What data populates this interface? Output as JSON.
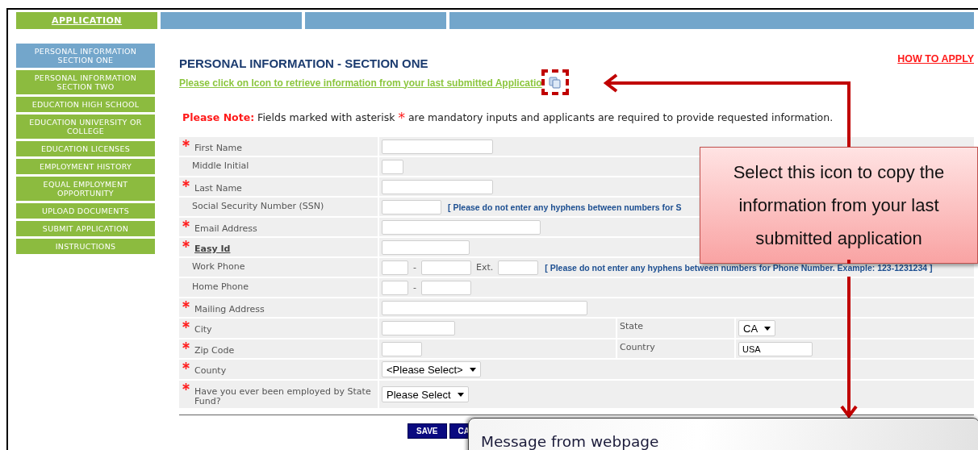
{
  "top_nav": {
    "tabs": [
      {
        "label": "APPLICATION",
        "selected": true
      },
      {
        "selected": false
      },
      {
        "selected": false
      },
      {
        "selected": false
      }
    ]
  },
  "sidebar": {
    "items": [
      {
        "label": "PERSONAL INFORMATION SECTION ONE",
        "selected": true
      },
      {
        "label": "PERSONAL INFORMATION SECTION TWO",
        "selected": false
      },
      {
        "label": "EDUCATION HIGH SCHOOL",
        "selected": false
      },
      {
        "label": "EDUCATION UNIVERSITY OR COLLEGE",
        "selected": false
      },
      {
        "label": "EDUCATION LICENSES",
        "selected": false
      },
      {
        "label": "EMPLOYMENT HISTORY",
        "selected": false
      },
      {
        "label": "EQUAL EMPLOYMENT OPPORTUNITY",
        "selected": false
      },
      {
        "label": "UPLOAD DOCUMENTS",
        "selected": false
      },
      {
        "label": "SUBMIT APPLICATION",
        "selected": false
      },
      {
        "label": "INSTRUCTIONS",
        "selected": false
      }
    ]
  },
  "header": {
    "title": "PERSONAL INFORMATION - SECTION ONE",
    "how_to_apply": "HOW TO APPLY",
    "retrieve_link": "Please click on Icon to retrieve information from your last submitted Applicatio"
  },
  "note": {
    "lead": "Please Note:",
    "before": "Fields marked with asterisk",
    "mark": "*",
    "after": "are mandatory inputs and applicants are required to provide requested information."
  },
  "form": {
    "rows": [
      {
        "kind": "text",
        "label": "First Name",
        "required": true
      },
      {
        "kind": "text",
        "label": "Middle Initial",
        "required": false
      },
      {
        "kind": "text",
        "label": "Last Name",
        "required": true
      },
      {
        "kind": "text",
        "label": "Social Security Number (SSN)",
        "required": false,
        "hint": "[ Please do not enter any hyphens between numbers for S"
      },
      {
        "kind": "text",
        "label": "Email Address",
        "required": true
      },
      {
        "kind": "text",
        "label": "Easy Id",
        "required": true,
        "link": true
      },
      {
        "kind": "phone",
        "label": "Work Phone",
        "required": false,
        "separator": "-",
        "ext_label": "Ext.",
        "hint": "[ Please do not enter any hyphens between numbers for Phone Number. Example: 123-1231234 ]"
      },
      {
        "kind": "phone",
        "label": "Home Phone",
        "required": false,
        "separator": "-"
      },
      {
        "kind": "text",
        "label": "Mailing Address",
        "required": true
      },
      {
        "kind": "text",
        "label": "City",
        "required": true,
        "side": {
          "label": "State",
          "kind": "select",
          "value": "CA"
        }
      },
      {
        "kind": "text",
        "label": "Zip Code",
        "required": true,
        "side": {
          "label": "Country",
          "kind": "text",
          "value": "USA"
        }
      },
      {
        "kind": "select",
        "label": "County",
        "required": true,
        "value": "<Please Select>"
      },
      {
        "kind": "select",
        "label": "Have you ever been employed by State Fund?",
        "required": true,
        "value": "Please Select"
      }
    ]
  },
  "buttons": [
    {
      "label": "SAVE"
    },
    {
      "label": "CA"
    }
  ],
  "callout": {
    "lines": [
      "Select this icon to copy the",
      "information from your last",
      "submitted application"
    ]
  },
  "dialog": {
    "title": "Message from webpage"
  }
}
